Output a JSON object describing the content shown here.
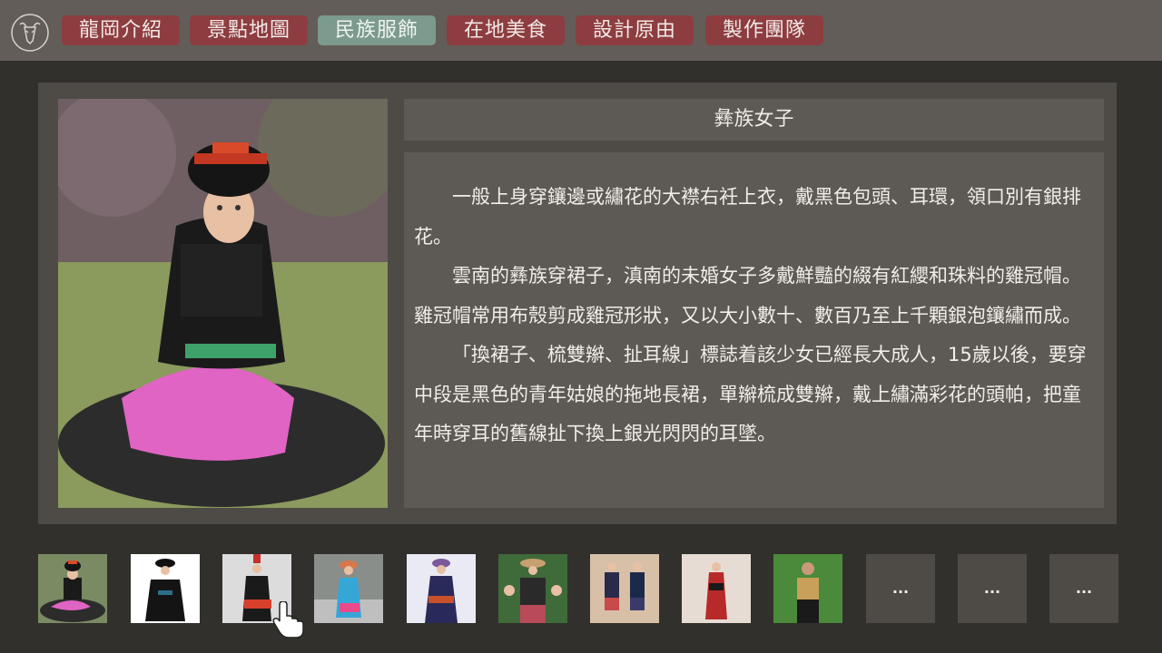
{
  "nav": {
    "items": [
      {
        "label": "龍岡介紹"
      },
      {
        "label": "景點地圖"
      },
      {
        "label": "民族服飾"
      },
      {
        "label": "在地美食"
      },
      {
        "label": "設計原由"
      },
      {
        "label": "製作團隊"
      }
    ],
    "active_index": 2
  },
  "content": {
    "title": "彝族女子",
    "paragraphs": [
      "一般上身穿鑲邊或繡花的大襟右衽上衣，戴黑色包頭、耳環，領口別有銀排花。",
      "雲南的彝族穿裙子，滇南的未婚女子多戴鮮豔的綴有紅纓和珠料的雞冠帽。雞冠帽常用布殼剪成雞冠形狀，又以大小數十、數百乃至上千顆銀泡鑲繡而成。",
      "「換裙子、梳雙辮、扯耳線」標誌着該少女已經長大成人，15歲以後，要穿中段是黑色的青年姑娘的拖地長裙，單辮梳成雙辮，戴上繡滿彩花的頭帕，把童年時穿耳的舊線扯下換上銀光閃閃的耳墜。"
    ]
  },
  "thumbnails": {
    "more_label": "..."
  },
  "colors": {
    "nav_button": "#8d3d40",
    "nav_active": "#7d9a8e",
    "background": "#32302c",
    "panel": "#4e4b47"
  }
}
